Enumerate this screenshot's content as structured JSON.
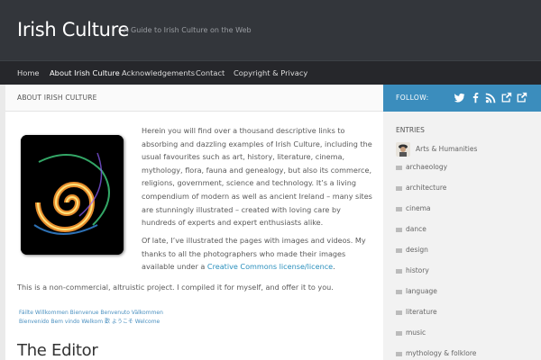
{
  "header": {
    "site_title": "Irish Culture",
    "tagline": "A Guide to Irish Culture on the Web"
  },
  "nav": {
    "items": [
      {
        "label": "Home",
        "active": false
      },
      {
        "label": "About Irish Culture",
        "active": true
      },
      {
        "label": "Acknowledgements",
        "active": false
      },
      {
        "label": "Contact",
        "active": false
      },
      {
        "label": "Copyright & Privacy",
        "active": false
      }
    ]
  },
  "page": {
    "heading": "ABOUT IRISH CULTURE",
    "paragraph1": "Herein you will find over a thousand descriptive links to absorbing and dazzling examples of Irish Culture, including the usual favourites such as art, history, literature, cinema, mythology, flora, fauna and genealogy, but also its commerce, religions, government, science and technology. It’s a living compendium of modern as well as ancient Ireland – many sites are stunningly illustrated – created with loving care by hundreds of experts and expert enthusiasts alike.",
    "paragraph2_before": "Of late, I’ve illustrated the pages with images and videos. My thanks to all the photographers who made their images available under a ",
    "paragraph2_link": "Creative Commons license/licence",
    "paragraph2_after": ".",
    "paragraph3": "This is a non-commercial, altruistic project. I compiled it for myself, and offer it to you.",
    "welcome_line1": "Fáilte Willkommen Bienvenue Benvenuto Välkommen",
    "welcome_line2": "Bienvenido Bem vindo Welkom 歡 ようこそ Welcome",
    "editor_heading": "The Editor"
  },
  "sidebar": {
    "follow_label": "FOLLOW:",
    "social_icons": [
      "twitter-icon",
      "facebook-icon",
      "rss-icon",
      "external-link-icon",
      "external-link-icon"
    ],
    "entries_title": "ENTRIES",
    "entries": [
      "Arts & Humanities",
      "archaeology",
      "architecture",
      "cinema",
      "dance",
      "design",
      "history",
      "language",
      "literature",
      "music",
      "mythology & folklore"
    ]
  },
  "colors": {
    "header_bg": "#33363b",
    "nav_bg": "#26272b",
    "follow_bar": "#3b8dbd",
    "link": "#2a8fbd"
  }
}
